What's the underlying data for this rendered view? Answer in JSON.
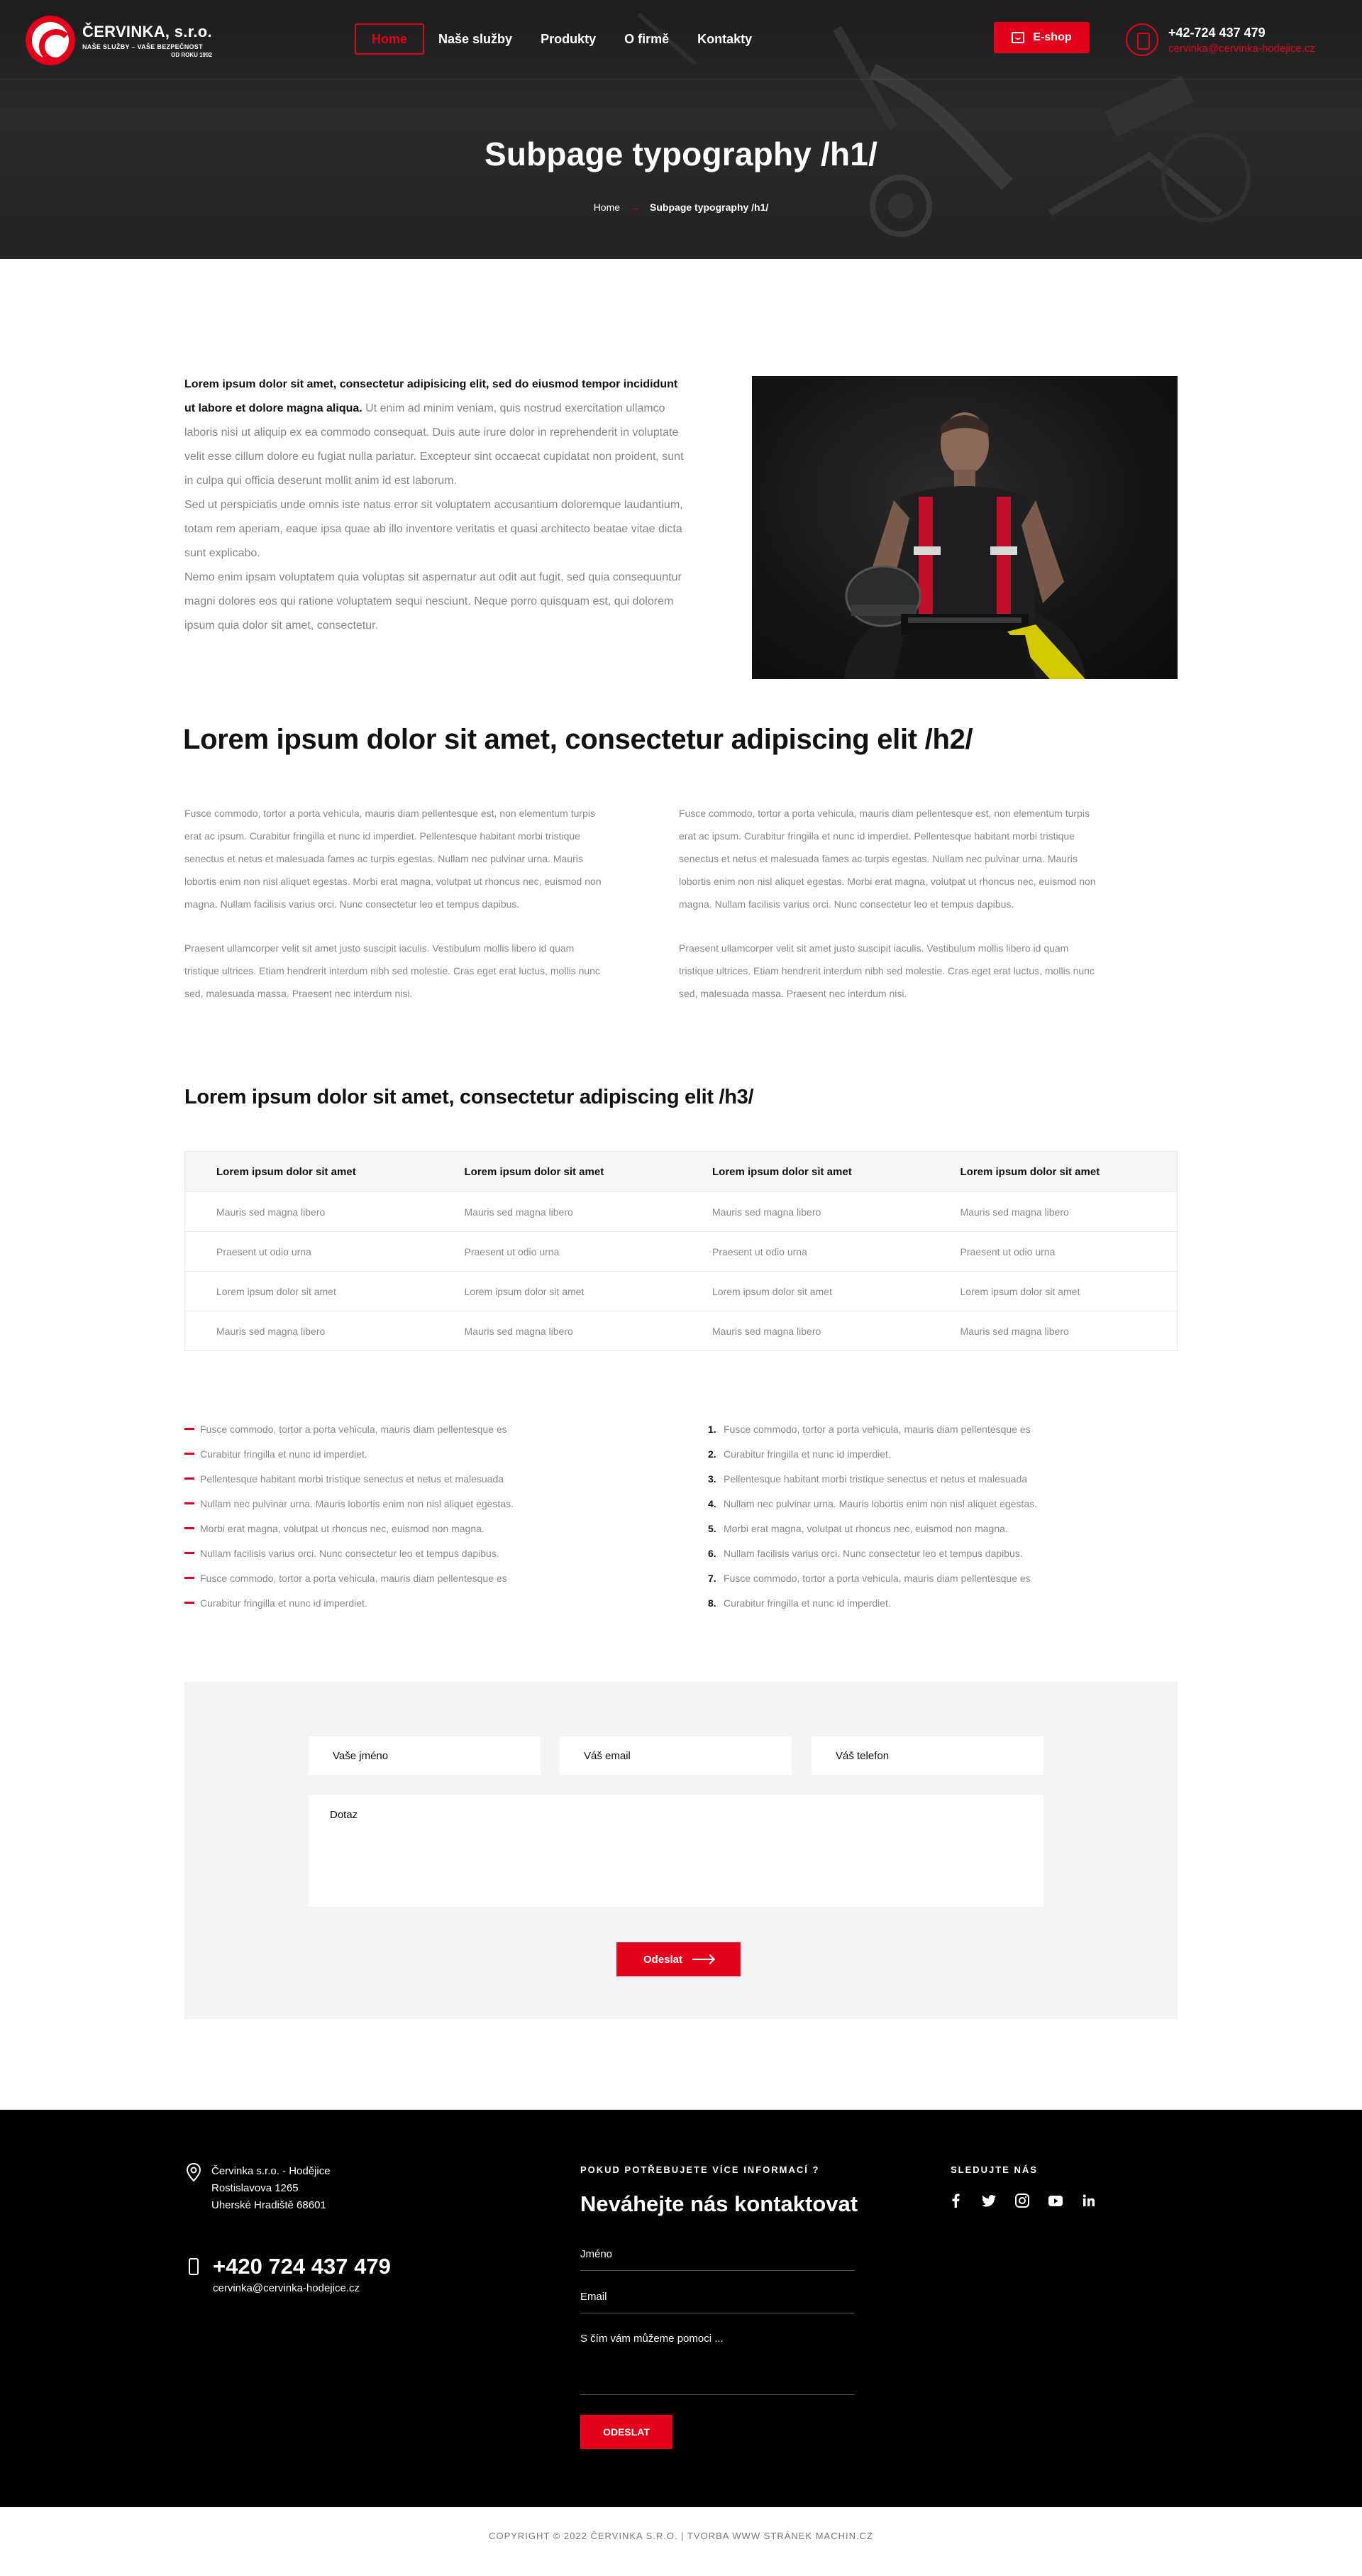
{
  "header": {
    "logo": {
      "name": "ČERVINKA, s.r.o.",
      "tagline": "NAŠE SLUŽBY – VAŠE BEZPEČNOST",
      "since": "OD ROKU 1992"
    },
    "nav": [
      "Home",
      "Naše služby",
      "Produkty",
      "O firmě",
      "Kontakty"
    ],
    "active_nav": "Home",
    "eshop_label": "E-shop",
    "phone": "+42-724 437 479",
    "email": "cervinka@cervinka-hodejice.cz"
  },
  "hero": {
    "title": "Subpage typography /h1/",
    "breadcrumb": {
      "home": "Home",
      "separator": "→",
      "current": "Subpage typography /h1/"
    }
  },
  "intro": {
    "lead_bold": "Lorem ipsum dolor sit amet, consectetur adipisicing elit, sed do eiusmod tempor incididunt ut labore et dolore magna aliqua.",
    "lead_rest": " Ut enim ad minim veniam, quis nostrud exercitation ullamco laboris nisi ut aliquip ex ea commodo consequat. Duis aute irure dolor in reprehenderit in voluptate velit esse cillum dolore eu fugiat nulla pariatur. Excepteur sint occaecat cupidatat non proident, sunt in culpa qui officia deserunt mollit anim id est laborum.",
    "p2": "Sed ut perspiciatis unde omnis iste natus error sit voluptatem accusantium doloremque laudantium, totam rem aperiam, eaque ipsa quae ab illo inventore veritatis et quasi architecto beatae vitae dicta sunt explicabo.",
    "p3": "Nemo enim ipsam voluptatem quia voluptas sit aspernatur aut odit aut fugit, sed quia consequuntur magni dolores eos qui ratione voluptatem sequi nesciunt. Neque porro quisquam est, qui dolorem ipsum quia dolor sit amet, consectetur."
  },
  "h2": "Lorem ipsum dolor sit amet, consectetur adipiscing elit /h2/",
  "columns": {
    "p1": "Fusce commodo, tortor a porta vehicula, mauris diam pellentesque est, non elementum turpis erat ac ipsum. Curabitur fringilla et nunc id imperdiet. Pellentesque habitant morbi tristique senectus et netus et malesuada fames ac turpis egestas. Nullam nec pulvinar urna. Mauris lobortis enim non nisl aliquet egestas. Morbi erat magna, volutpat ut rhoncus nec, euismod non magna. Nullam facilisis varius orci. Nunc consectetur leo et tempus dapibus.",
    "p2": "Praesent ullamcorper velit sit amet justo suscipit iaculis. Vestibulum mollis libero id quam tristique ultrices. Etiam hendrerit interdum nibh sed molestie. Cras eget erat luctus, mollis nunc sed, malesuada massa. Praesent nec interdum nisi."
  },
  "h3": "Lorem ipsum dolor sit amet, consectetur adipiscing elit /h3/",
  "table": {
    "headers": [
      "Lorem ipsum dolor sit amet",
      "Lorem ipsum dolor sit amet",
      "Lorem ipsum dolor sit amet",
      "Lorem ipsum dolor sit amet"
    ],
    "rows": [
      [
        "Mauris sed magna libero",
        "Mauris sed magna libero",
        "Mauris sed magna libero",
        "Mauris sed magna libero"
      ],
      [
        "Praesent ut odio urna",
        "Praesent ut odio urna",
        "Praesent ut odio urna",
        "Praesent ut odio urna"
      ],
      [
        "Lorem ipsum dolor sit amet",
        "Lorem ipsum dolor sit amet",
        "Lorem ipsum dolor sit amet",
        "Lorem ipsum dolor sit amet"
      ],
      [
        "Mauris sed magna libero",
        "Mauris sed magna libero",
        "Mauris sed magna libero",
        "Mauris sed magna libero"
      ]
    ]
  },
  "lists": {
    "bullet": [
      "Fusce commodo, tortor a porta vehicula, mauris diam pellentesque es",
      "Curabitur fringilla et nunc id imperdiet.",
      "Pellentesque habitant morbi tristique senectus et netus et malesuada",
      "Nullam nec pulvinar urna. Mauris lobortis enim non nisl aliquet egestas.",
      "Morbi erat magna, volutpat ut rhoncus nec, euismod non magna.",
      "Nullam facilisis varius orci. Nunc consectetur leo et tempus dapibus.",
      "Fusce commodo, tortor a porta vehicula, mauris diam pellentesque es",
      "Curabitur fringilla et nunc id imperdiet."
    ],
    "numbered": [
      "Fusce commodo, tortor a porta vehicula, mauris diam pellentesque es",
      "Curabitur fringilla et nunc id imperdiet.",
      "Pellentesque habitant morbi tristique senectus et netus et malesuada",
      "Nullam nec pulvinar urna. Mauris lobortis enim non nisl aliquet egestas.",
      "Morbi erat magna, volutpat ut rhoncus nec, euismod non magna.",
      "Nullam facilisis varius orci. Nunc consectetur leo et tempus dapibus.",
      "Fusce commodo, tortor a porta vehicula, mauris diam pellentesque es",
      "Curabitur fringilla et nunc id imperdiet."
    ]
  },
  "form": {
    "name": "Vaše jméno",
    "email": "Váš email",
    "phone": "Váš telefon",
    "question": "Dotaz",
    "submit": "Odeslat"
  },
  "footer": {
    "address": [
      "Červinka s.r.o. - Hodějice",
      "Rostislavova 1265",
      "Uherské Hradiště 68601"
    ],
    "phone": "+420 724 437 479",
    "email": "cervinka@cervinka-hodejice.cz",
    "kicker": "POKUD POTŘEBUJETE VÍCE INFORMACÍ ?",
    "heading": "Neváhejte nás kontaktovat",
    "field_name": "Jméno",
    "field_email": "Email",
    "field_message": "S čím vám můžeme pomoci ...",
    "submit": "ODESLAT",
    "social_title": "SLEDUJTE NÁS",
    "social": [
      "facebook-icon",
      "twitter-icon",
      "instagram-icon",
      "youtube-icon",
      "linkedin-icon"
    ]
  },
  "copyright": "COPYRIGHT © 2022 ČERVINKA S.R.O. | TVORBA WWW STRÁNEK MACHIN.CZ",
  "colors": {
    "accent": "#e2001a",
    "dark": "#000000",
    "hero": "#252525",
    "panel": "#f4f4f4"
  }
}
